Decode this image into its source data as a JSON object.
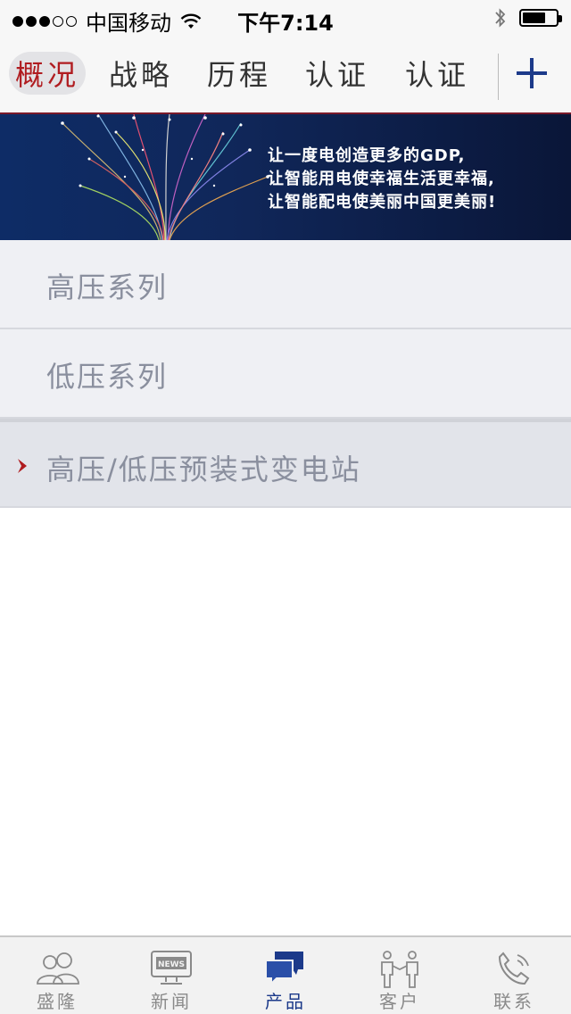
{
  "status_bar": {
    "carrier": "中国移动",
    "time": "下午7:14",
    "signal_bars_filled": 3,
    "signal_bars_total": 5,
    "battery_level": 0.7
  },
  "tabs": [
    {
      "label": "概况",
      "active": true
    },
    {
      "label": "战略",
      "active": false
    },
    {
      "label": "历程",
      "active": false
    },
    {
      "label": "认证",
      "active": false
    },
    {
      "label": "认证",
      "active": false
    }
  ],
  "banner": {
    "line1": "让一度电创造更多的GDP,",
    "line2": "让智能用电使幸福生活更幸福,",
    "line3": "让智能配电使美丽中国更美丽!"
  },
  "list": [
    {
      "label": "高压系列",
      "selected": false
    },
    {
      "label": "低压系列",
      "selected": false
    },
    {
      "label": "高压/低压预装式变电站",
      "selected": true
    }
  ],
  "bottom_nav": [
    {
      "label": "盛隆",
      "icon": "users-icon",
      "active": false
    },
    {
      "label": "新闻",
      "icon": "news-icon",
      "active": false
    },
    {
      "label": "产品",
      "icon": "chat-bubbles-icon",
      "active": true
    },
    {
      "label": "客户",
      "icon": "handshake-icon",
      "active": false
    },
    {
      "label": "联系",
      "icon": "phone-icon",
      "active": false
    }
  ],
  "colors": {
    "accent_red": "#b01c20",
    "accent_blue": "#1c3a8a",
    "banner_bg": "#0e2c66"
  }
}
